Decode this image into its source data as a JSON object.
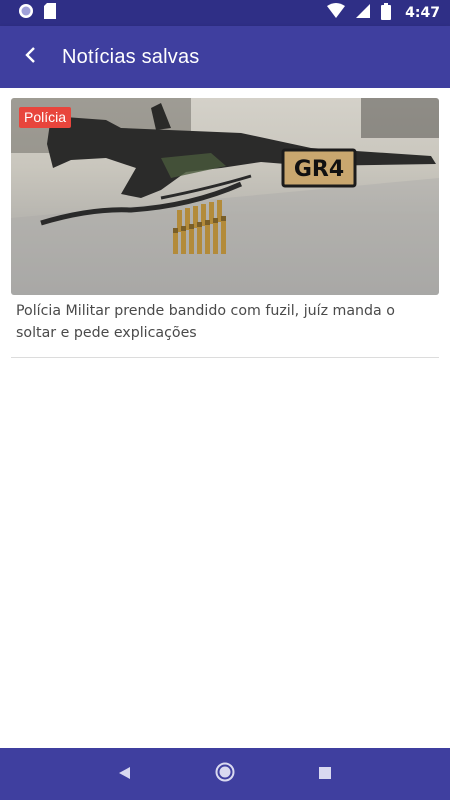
{
  "status_bar": {
    "time": "4:47",
    "icons": [
      "circle-notification-icon",
      "sd-card-icon",
      "wifi-icon",
      "cellular-signal-icon",
      "battery-icon"
    ]
  },
  "app_bar": {
    "title": "Notícias salvas",
    "back_icon": "chevron-left-icon"
  },
  "news": [
    {
      "category": "Polícia",
      "title": "Polícia Militar prende bandido com fuzil, juíz manda o soltar e pede explicações",
      "image_text": "GR4"
    }
  ],
  "nav_bar": {
    "icons": [
      "back-triangle-icon",
      "home-circle-icon",
      "recents-square-icon"
    ]
  },
  "colors": {
    "status_bar": "#2f2f86",
    "app_bar": "#3f3f9f",
    "badge": "#e8453c",
    "text": "#4a4a4a"
  }
}
